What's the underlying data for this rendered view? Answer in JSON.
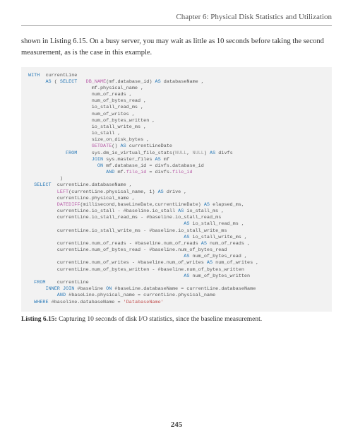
{
  "chapter_header": "Chapter 6: Physical Disk Statistics and Utilization",
  "body_text": "shown in Listing 6.15. On a busy server, you may wait as little as 10 seconds before taking the second measurement, as is the case in this example.",
  "code": {
    "l1a": "WITH",
    "l1b": "  currentLine",
    "l2a": "      AS",
    "l2b": " ( ",
    "l2c": "SELECT",
    "l2d": "   ",
    "l2e": "DB_NAME",
    "l2f": "(mf.database_id) ",
    "l2g": "AS",
    "l2h": " databaseName ,",
    "l3": "                      mf.physical_name ,",
    "l4": "                      num_of_reads ,",
    "l5": "                      num_of_bytes_read ,",
    "l6": "                      io_stall_read_ms ,",
    "l7": "                      num_of_writes ,",
    "l8": "                      num_of_bytes_written ,",
    "l9": "                      io_stall_write_ms ,",
    "l10": "                      io_stall ,",
    "l11": "                      size_on_disk_bytes ,",
    "l12a": "                      ",
    "l12b": "GETDATE",
    "l12c": "() ",
    "l12d": "AS",
    "l12e": " currentLineDate",
    "l13a": "             FROM",
    "l13b": "     sys.dm_io_virtual_file_stats(",
    "l13c": "NULL",
    "l13d": ", ",
    "l13e": "NULL",
    "l13f": ") ",
    "l13g": "AS",
    "l13h": " divfs",
    "l14a": "                      ",
    "l14b": "JOIN",
    "l14c": " sys.master_files ",
    "l14d": "AS",
    "l14e": " mf",
    "l15a": "                        ",
    "l15b": "ON",
    "l15c": " mf.database_id = divfs.database_id",
    "l16a": "                           ",
    "l16b": "AND",
    "l16c": " mf.",
    "l16d": "file_id",
    "l16e": " = divfs.",
    "l16f": "file_id",
    "l17": "           )",
    "l18a": "  SELECT",
    "l18b": "  currentLine.databaseName ,",
    "l19a": "          ",
    "l19b": "LEFT",
    "l19c": "(currentLine.physical_name, 1) ",
    "l19d": "AS",
    "l19e": " drive ,",
    "l20": "          currentLine.physical_name ,",
    "l21a": "          ",
    "l21b": "DATEDIFF",
    "l21c": "(millisecond,baseLineDate,currentLineDate) ",
    "l21d": "AS",
    "l21e": " elapsed_ms,",
    "l22a": "          currentLine.io_stall - #baseline.io_stall ",
    "l22b": "AS",
    "l22c": " io_stall_ms ,",
    "l23": "          currentLine.io_stall_read_ms - #baseline.io_stall_read_ms",
    "l24a": "                                                      ",
    "l24b": "AS",
    "l24c": " io_stall_read_ms ,",
    "l25": "          currentLine.io_stall_write_ms - #baseline.io_stall_write_ms",
    "l26a": "                                                      ",
    "l26b": "AS",
    "l26c": " io_stall_write_ms ,",
    "l27a": "          currentLine.num_of_reads - #baseline.num_of_reads ",
    "l27b": "AS",
    "l27c": " num_of_reads ,",
    "l28": "          currentLine.num_of_bytes_read - #baseline.num_of_bytes_read",
    "l29a": "                                                      ",
    "l29b": "AS",
    "l29c": " num_of_bytes_read ,",
    "l30a": "          currentLine.num_of_writes - #baseline.num_of_writes ",
    "l30b": "AS",
    "l30c": " num_of_writes ,",
    "l31": "          currentLine.num_of_bytes_written - #baseline.num_of_bytes_written",
    "l32a": "                                                      ",
    "l32b": "AS",
    "l32c": " num_of_bytes_written",
    "l33a": "  FROM",
    "l33b": "    currentLine",
    "l34a": "      ",
    "l34b": "INNER JOIN",
    "l34c": " #baseline ",
    "l34d": "ON",
    "l34e": " #baseLine.databaseName = currentLine.databaseName",
    "l35a": "          ",
    "l35b": "AND",
    "l35c": " #baseLine.physical_name = currentLine.physical_name",
    "l36a": "  WHERE",
    "l36b": " #baseline.databaseName = ",
    "l36c": "'DatabaseName'"
  },
  "caption_label": "Listing 6.15:",
  "caption_text": "  Capturing 10 seconds of disk I/O statistics, since the baseline measurement.",
  "page_number": "245"
}
